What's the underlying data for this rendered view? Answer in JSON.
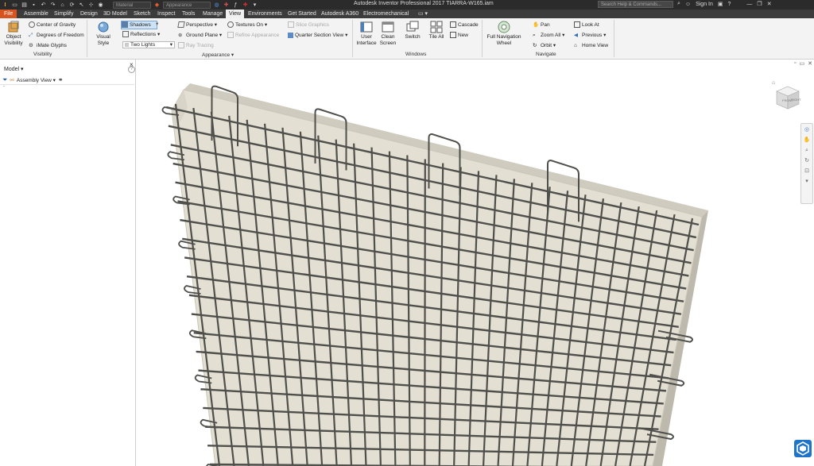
{
  "app": {
    "title": "Autodesk Inventor Professional 2017   TIARRA-W165.iam",
    "search_placeholder": "Search Help & Commands...",
    "sign_in": "Sign In",
    "help": "?",
    "material_placeholder": "Material",
    "appearance_placeholder": "Appearance"
  },
  "tabs": [
    "File",
    "Assemble",
    "Simplify",
    "Design",
    "3D Model",
    "Sketch",
    "Inspect",
    "Tools",
    "Manage",
    "View",
    "Environments",
    "Get Started",
    "Autodesk A360",
    "Electromechanical"
  ],
  "active_tab": "View",
  "ribbon": {
    "visibility": {
      "label": "Visibility",
      "object_visibility": "Object Visibility",
      "items": [
        "Center of Gravity",
        "Degrees of Freedom",
        "iMate Glyphs"
      ]
    },
    "appearance": {
      "label": "Appearance",
      "visual_style": "Visual Style",
      "col1": [
        "Shadows",
        "Reflections",
        "Two Lights"
      ],
      "col2": [
        "Perspective",
        "Ground Plane",
        "Ray Tracing"
      ],
      "col3": [
        "Textures On",
        "Refine Appearance"
      ],
      "col4": [
        "Slice Graphics",
        "Quarter Section View"
      ]
    },
    "windows": {
      "label": "Windows",
      "user_interface": "User Interface",
      "clean_screen": "Clean Screen",
      "switch": "Switch",
      "tile_all": "Tile All",
      "cascade": "Cascade",
      "new": "New"
    },
    "navigate": {
      "label": "Navigate",
      "full_navigation_wheel": "Full Navigation Wheel",
      "col1": [
        "Pan",
        "Zoom All",
        "Orbit"
      ],
      "col2": [
        "Look At",
        "Previous",
        "Home View"
      ]
    }
  },
  "browser": {
    "title": "Model",
    "view_label": "Assembly View",
    "close": "×",
    "help": "?"
  },
  "viewcube": {
    "front": "FRONT",
    "right": "RIGHT"
  },
  "viewport_controls": [
    "▫",
    "▭",
    "✕"
  ],
  "colors": {
    "file_tab": "#d9531e",
    "title_bar": "#2b2b2b",
    "tab_bar": "#3c3c3c",
    "ribbon": "#f3f3f3",
    "slab": "#e3dfd3",
    "rebar": "#4f4f4b"
  }
}
